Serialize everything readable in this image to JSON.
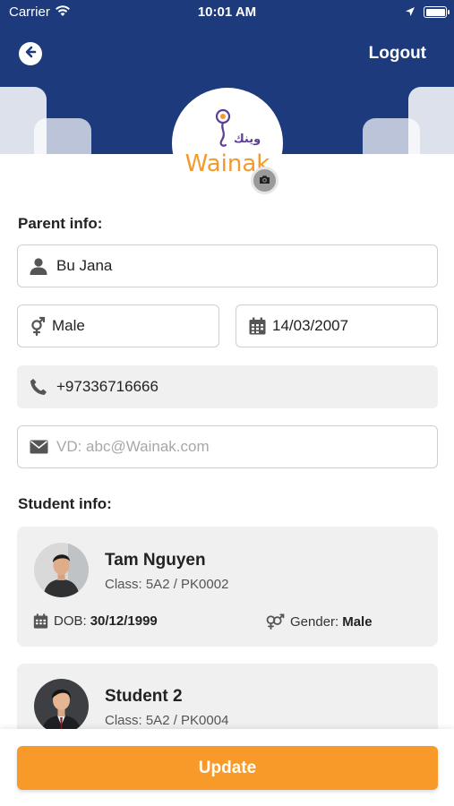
{
  "status_bar": {
    "carrier": "Carrier",
    "time": "10:01 AM"
  },
  "header": {
    "logout_label": "Logout",
    "logo_text": "Wainak",
    "logo_arabic": "وينك"
  },
  "colors": {
    "header_bg": "#1d3a7c",
    "accent": "#f79a2a",
    "logo_orange": "#f29a2e",
    "logo_purple": "#5a3e98"
  },
  "parent": {
    "section_title": "Parent info:",
    "name": "Bu Jana",
    "gender": "Male",
    "dob": "14/03/2007",
    "phone": "+97336716666",
    "email_placeholder": "VD: abc@Wainak.com"
  },
  "students": {
    "section_title": "Student info:",
    "items": [
      {
        "name": "Tam Nguyen",
        "class": "Class: 5A2 / PK0002",
        "dob_label": "DOB:",
        "dob": "30/12/1999",
        "gender_label": "Gender:",
        "gender": "Male"
      },
      {
        "name": "Student 2",
        "class": "Class: 5A2 / PK0004"
      }
    ]
  },
  "actions": {
    "update_label": "Update"
  }
}
